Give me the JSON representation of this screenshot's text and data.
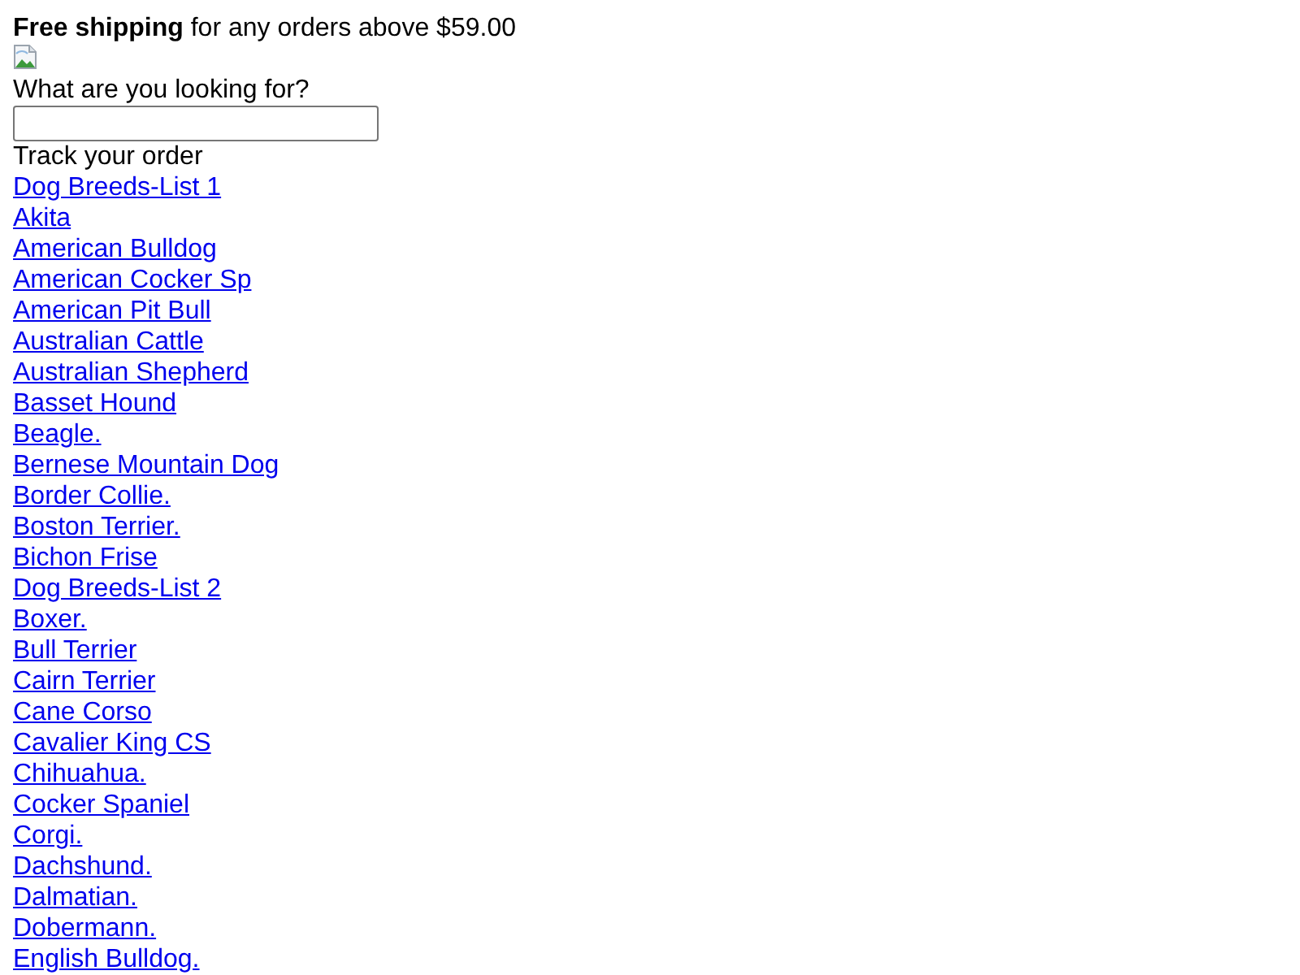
{
  "banner": {
    "text": "**Free shipping** for any orders above $59.00"
  },
  "logo": {
    "kind": "broken-image"
  },
  "search": {
    "label": "What are you looking for?"
  },
  "track_order": {
    "text": "Track your order"
  },
  "links": [
    "Dog Breeds-List 1",
    "Akita",
    "American Bulldog",
    "American Cocker Sp",
    "American Pit Bull",
    "Australian Cattle",
    "Australian Shepherd",
    "Basset Hound",
    "Beagle.",
    "Bernese Mountain Dog",
    "Border Collie.",
    "Boston Terrier.",
    "Bichon Frise",
    "Dog Breeds-List 2",
    "Boxer.",
    "Bull Terrier",
    "Cairn Terrier",
    "Cane Corso",
    "Cavalier King CS",
    "Chihuahua.",
    "Cocker Spaniel",
    "Corgi.",
    "Dachshund.",
    "Dalmatian.",
    "Dobermann.",
    "English Bulldog."
  ]
}
